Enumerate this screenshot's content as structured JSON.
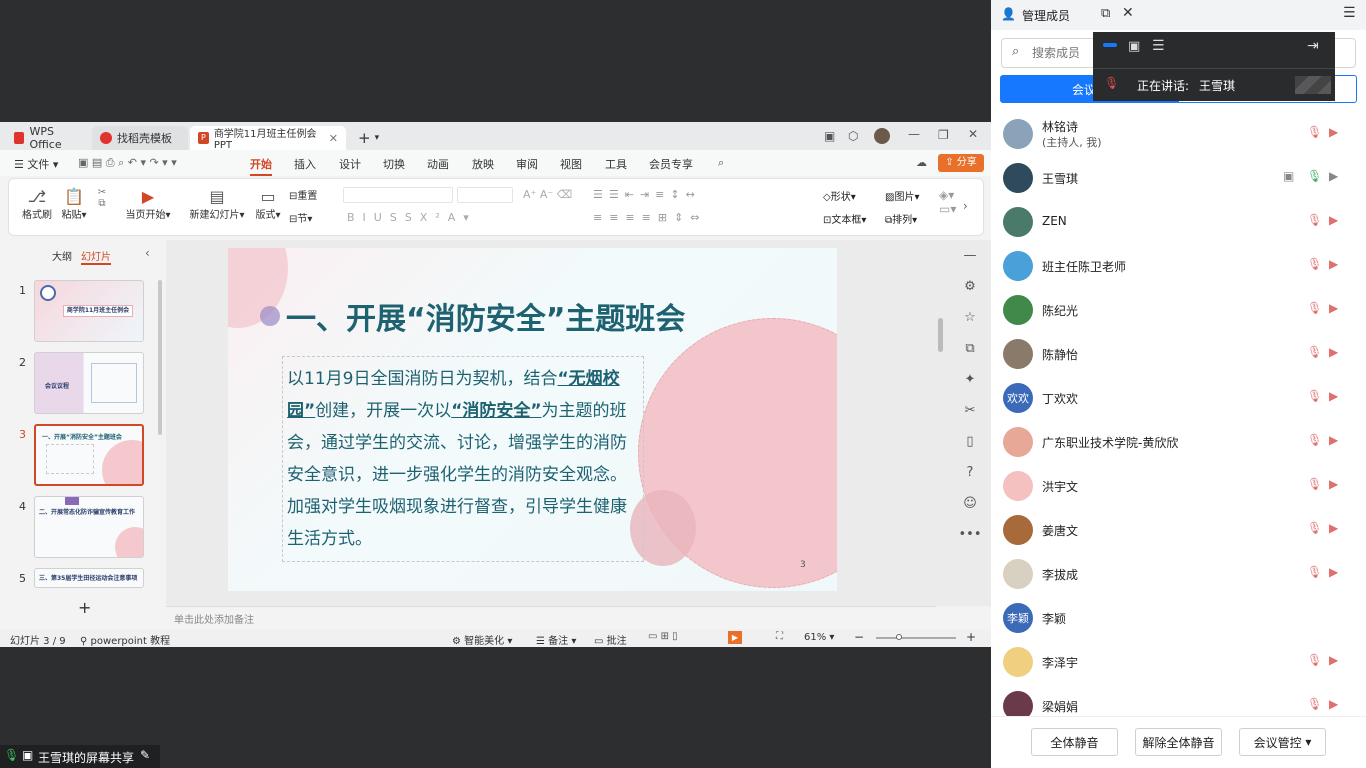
{
  "wps": {
    "tabs": [
      {
        "label": "WPS Office",
        "color": "#e0332b"
      },
      {
        "label": "找稻壳模板",
        "color": "#e0332b"
      },
      {
        "label": "商学院11月班主任例会PPT",
        "color": "#d24726"
      }
    ],
    "file_menu": "文件",
    "menus": [
      "开始",
      "插入",
      "设计",
      "切换",
      "动画",
      "放映",
      "审阅",
      "视图",
      "工具",
      "会员专享"
    ],
    "active_menu": "开始",
    "share_label": "分享",
    "ribbon": {
      "format_painter": "格式刷",
      "paste": "粘贴",
      "from_current": "当页开始",
      "new_slide": "新建幻灯片",
      "layout": "版式",
      "section": "节",
      "reset": "重置",
      "shape": "形状",
      "picture": "图片",
      "textbox": "文本框",
      "arrange": "排列"
    },
    "panel_tabs": {
      "outline": "大纲",
      "slides": "幻灯片"
    },
    "thumbs": [
      {
        "num": "1",
        "title": "商学院11月班主任例会"
      },
      {
        "num": "2",
        "title": "会议议程"
      },
      {
        "num": "3",
        "title": "一、开展“消防安全”主题班会"
      },
      {
        "num": "4",
        "title": "二、开展常态化防诈骗宣传教育工作"
      },
      {
        "num": "5",
        "title": "三、第35届学生田径运动会注意事项"
      }
    ],
    "slide": {
      "title": "一、开展“消防安全”主题班会",
      "body_parts": [
        {
          "t": "以11月9日全国消防日为契机，结合",
          "u": false
        },
        {
          "t": "“无烟校园”",
          "u": true
        },
        {
          "t": "创建，开展一次以",
          "u": false
        },
        {
          "t": "“消防安全”",
          "u": true
        },
        {
          "t": "为主题的班会，通过学生的交流、讨论，增强学生的消防安全意识，进一步强化学生的消防安全观念。加强对学生吸烟现象进行督查，引导学生健康生活方式。",
          "u": false
        }
      ],
      "page_num": "3"
    },
    "notes_placeholder": "单击此处添加备注",
    "status": {
      "slide_count": "幻灯片 3 / 9",
      "template": "powerpoint 教程",
      "beautify": "智能美化",
      "notes": "备注",
      "comments": "批注",
      "zoom": "61%"
    }
  },
  "panel": {
    "title": "管理成员",
    "search_placeholder": "搜索成员",
    "in_meeting_tab": "会议中",
    "speaking_label": "正在讲话:",
    "speaking_name": "王雪琪",
    "members": [
      {
        "name": "林铭诗",
        "sub": "(主持人, 我)",
        "avatar": "#8aa3b8",
        "mic": "off",
        "cam": "off"
      },
      {
        "name": "王雪琪",
        "avatar": "#2f4a5c",
        "mic": "on",
        "cam": "screen"
      },
      {
        "name": "ZEN",
        "avatar": "#4a7a6a",
        "mic": "off",
        "cam": "off"
      },
      {
        "name": "班主任陈卫老师",
        "avatar": "#4aa0d8",
        "mic": "off",
        "cam": "off"
      },
      {
        "name": "陈纪光",
        "avatar": "#3f8a4a",
        "mic": "off",
        "cam": "off"
      },
      {
        "name": "陈静怡",
        "avatar": "#8a7a6a",
        "mic": "off",
        "cam": "off"
      },
      {
        "name": "丁欢欢",
        "avatar": "#3a6ab8",
        "text": "欢欢",
        "mic": "off",
        "cam": "off"
      },
      {
        "name": "广东职业技术学院-黄欣欣",
        "avatar": "#e8a898",
        "mic": "off",
        "cam": "off"
      },
      {
        "name": "洪宇文",
        "avatar": "#f4c0c0",
        "mic": "off",
        "cam": "off"
      },
      {
        "name": "姜唐文",
        "avatar": "#a86a3a",
        "mic": "off",
        "cam": "off"
      },
      {
        "name": "李拔成",
        "avatar": "#d8d0c0",
        "mic": "off",
        "cam": "off"
      },
      {
        "name": "李颖",
        "avatar": "#3a6ab8",
        "text": "李颖",
        "mic": "none",
        "cam": "none"
      },
      {
        "name": "李泽宇",
        "avatar": "#f0d080",
        "mic": "off",
        "cam": "off"
      },
      {
        "name": "梁娟娟",
        "avatar": "#6a3a4a",
        "mic": "off",
        "cam": "off"
      }
    ],
    "buttons": {
      "mute_all": "全体静音",
      "unmute_all": "解除全体静音",
      "control": "会议管控"
    }
  },
  "sharebar": {
    "label": "王雪琪的屏幕共享"
  }
}
